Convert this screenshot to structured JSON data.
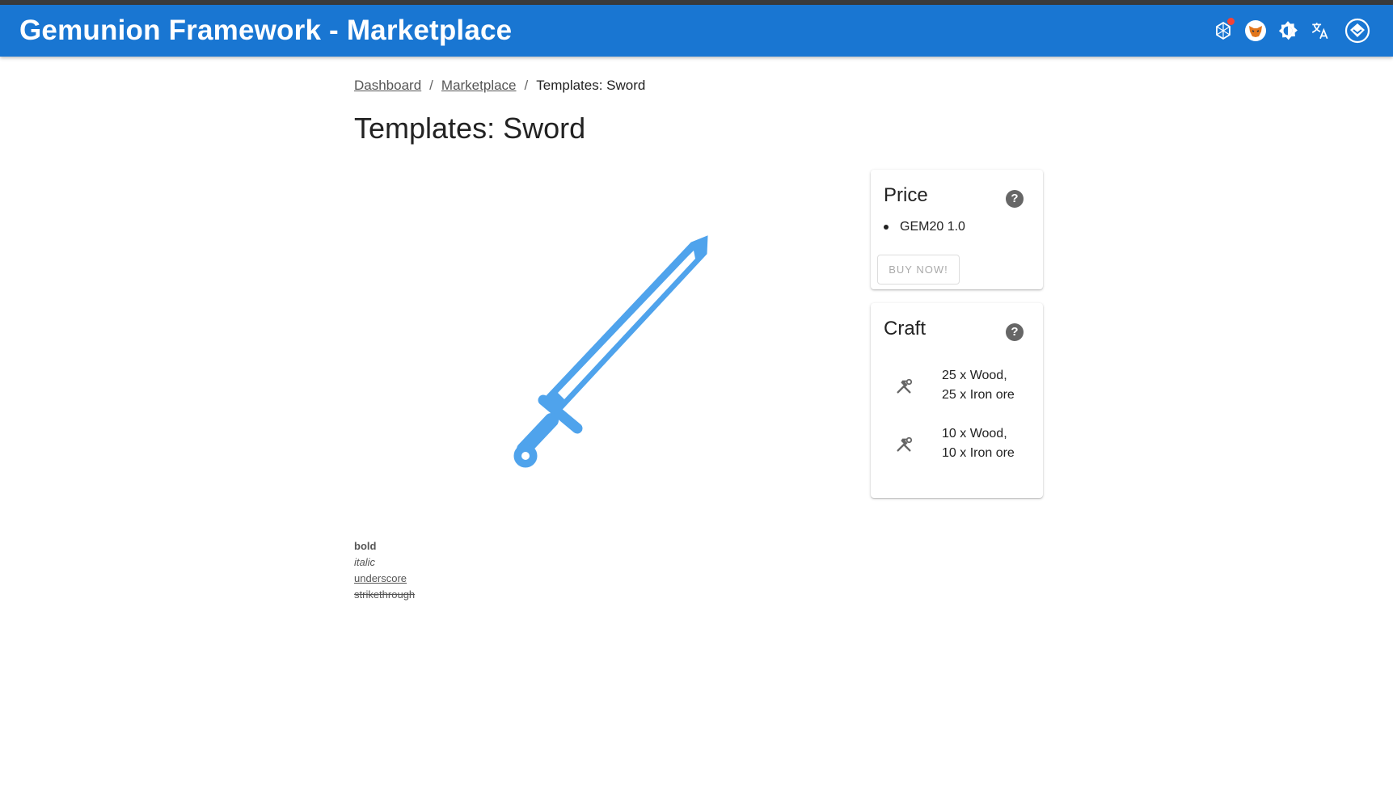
{
  "app": {
    "title": "Gemunion Framework - Marketplace"
  },
  "header_icons": [
    "network-icon",
    "metamask-fox-icon",
    "brightness-icon",
    "translate-icon",
    "profile-icon"
  ],
  "breadcrumb": {
    "items": [
      "Dashboard",
      "Marketplace"
    ],
    "current": "Templates: Sword",
    "separator": "/"
  },
  "page": {
    "title": "Templates: Sword"
  },
  "image": {
    "icon": "sword-icon",
    "color": "#4fa3ec"
  },
  "price": {
    "title": "Price",
    "items": [
      "GEM20 1.0"
    ],
    "buy_label": "BUY NOW!"
  },
  "craft": {
    "title": "Craft",
    "recipes": [
      {
        "line1": "25 x Wood,",
        "line2": "25 x Iron ore"
      },
      {
        "line1": "10 x Wood,",
        "line2": "10 x Iron ore"
      }
    ]
  },
  "description": {
    "bold": "bold",
    "italic": "italic",
    "underscore": "underscore",
    "strikethrough": "strikethrough"
  },
  "colors": {
    "appbar": "#1976d2",
    "accent": "#4fa3ec",
    "notification": "#f44336"
  }
}
